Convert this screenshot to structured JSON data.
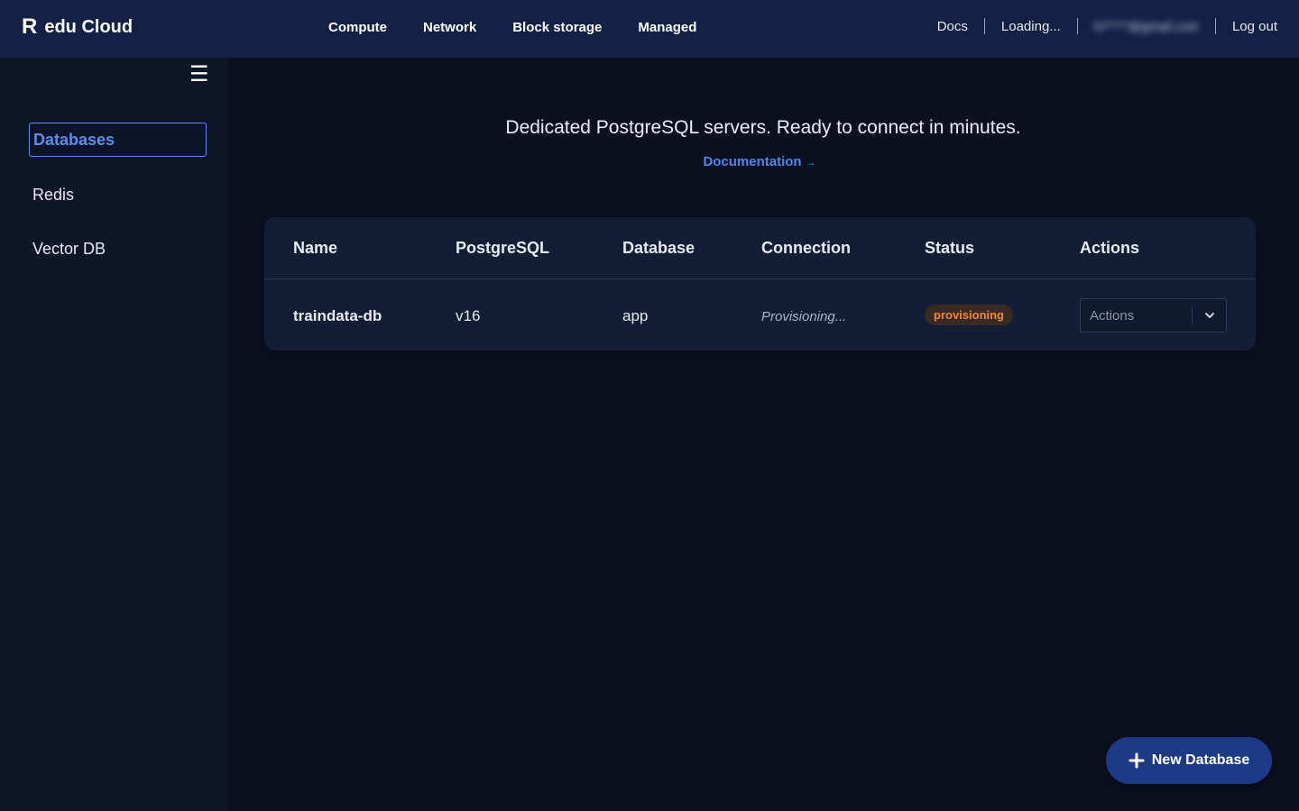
{
  "header": {
    "brand_logo": "R",
    "brand_name": "edu Cloud",
    "nav": [
      "Compute",
      "Network",
      "Block storage",
      "Managed"
    ],
    "docs_label": "Docs",
    "loading_label": "Loading...",
    "user_email": "hi*****@gmail.com",
    "logout_label": "Log out"
  },
  "sidebar": {
    "items": [
      {
        "label": "Databases",
        "active": true
      },
      {
        "label": "Redis",
        "active": false
      },
      {
        "label": "Vector DB",
        "active": false
      }
    ]
  },
  "main": {
    "tagline": "Dedicated PostgreSQL servers. Ready to connect in minutes.",
    "doc_link": "Documentation",
    "doc_arrow": "→",
    "table": {
      "headers": [
        "Name",
        "PostgreSQL",
        "Database",
        "Connection",
        "Status",
        "Actions"
      ],
      "rows": [
        {
          "name": "traindata-db",
          "postgres": "v16",
          "database": "app",
          "connection": "Provisioning...",
          "status": "provisioning",
          "actions_placeholder": "Actions"
        }
      ]
    },
    "new_button": "New Database"
  },
  "colors": {
    "accent": "#4f86ee",
    "header_bg": "#132145",
    "status_provisioning": "#f0893c"
  }
}
